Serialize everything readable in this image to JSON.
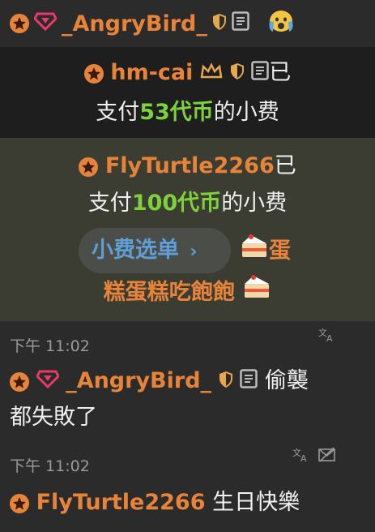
{
  "row1": {
    "user": "_AngryBird_"
  },
  "tip1": {
    "user": "hm-cai",
    "suffix": "已",
    "line2_pre": "支付",
    "amount": "53代币",
    "line2_post": "的小费"
  },
  "tip2": {
    "user": "FlyTurtle2266",
    "suffix": "已",
    "line2_pre": "支付",
    "amount": "100代币",
    "line2_post": "的小费",
    "menu_label": "小费选单",
    "menu_chevron": "›",
    "item_part1": "蛋",
    "item_part2": "糕蛋糕吃飽飽"
  },
  "msg1": {
    "time": "下午 11:02",
    "user": "_AngryBird_",
    "text1": "偷襲",
    "text2": "都失敗了"
  },
  "msg2": {
    "time": "下午 11:02",
    "user": "FlyTurtle2266",
    "text": "生日快樂"
  }
}
